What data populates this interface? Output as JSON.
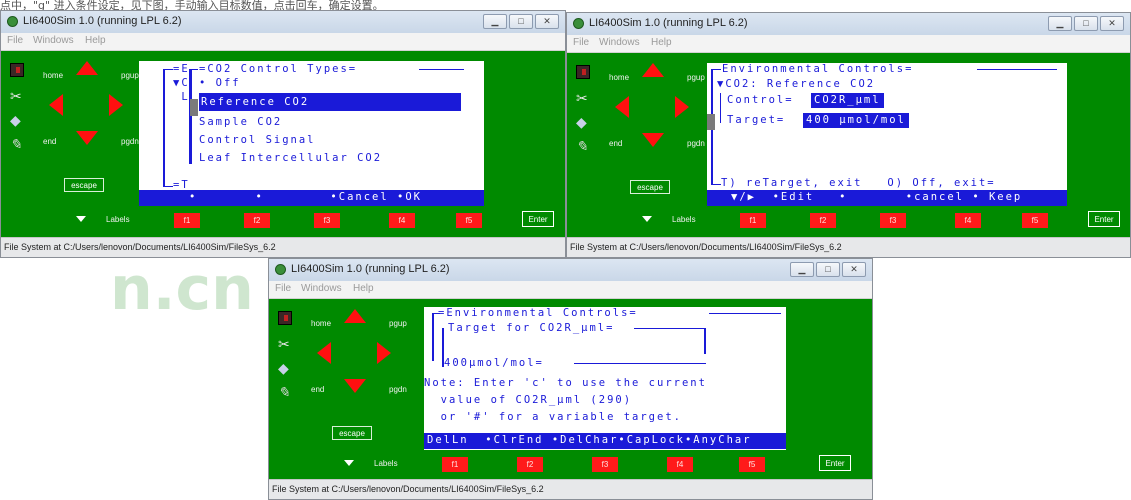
{
  "header_fragment": "点中，\"g\" 进入条件设定，见下图，手动输入目标数值，点击回车，确定设置。",
  "watermark": "n.cn",
  "colors": {
    "lcd_text": "#1a1ad8",
    "panel_green": "#008a00",
    "keys_red": "#ff1a1a"
  },
  "icons": [
    "app-icon",
    "minimize-icon",
    "maximize-icon",
    "close-icon",
    "record-tool-icon",
    "tools-icon",
    "chip-icon",
    "pen-icon",
    "up-arrow-icon",
    "down-arrow-icon",
    "left-arrow-icon",
    "right-arrow-icon",
    "labels-triangle-icon"
  ],
  "windows": [
    {
      "title": "LI6400Sim 1.0 (running LPL 6.2)",
      "menu": [
        "File",
        "Windows",
        "Help"
      ],
      "status": "File System at C:/Users/lenovon/Documents/LI6400Sim/FileSys_6.2",
      "controls": {
        "home": "home",
        "pgup": "pgup",
        "end": "end",
        "pgdn": "pgdn",
        "escape": "escape",
        "labels": "Labels",
        "enter": "Enter"
      },
      "fkeys": [
        "f1",
        "f2",
        "f3",
        "f4",
        "f5"
      ],
      "screen": {
        "bg_lines": [
          "=E",
          "▼C",
          " L",
          "",
          "",
          "",
          "",
          "",
          "=T"
        ],
        "box_title": "=CO2 Control Types=",
        "items": [
          "• Off",
          "Reference CO2",
          "Sample CO2",
          "Control Signal",
          "Leaf Intercellular CO2"
        ],
        "selected_index": 1,
        "bottom": "   •       •        •Cancel •OK"
      }
    },
    {
      "title": "LI6400Sim 1.0 (running LPL 6.2)",
      "menu": [
        "File",
        "Windows",
        "Help"
      ],
      "status": "File System at C:/Users/lenovon/Documents/LI6400Sim/FileSys_6.2",
      "controls": {
        "home": "home",
        "pgup": "pgup",
        "end": "end",
        "pgdn": "pgdn",
        "escape": "escape",
        "labels": "Labels",
        "enter": "Enter"
      },
      "fkeys": [
        "f1",
        "f2",
        "f3",
        "f4",
        "f5"
      ],
      "screen": {
        "title": "Environmental Controls=",
        "co2_line": "▼CO2: Reference CO2",
        "control_label": "Control=",
        "control_value": "CO2R_µml",
        "target_label": "Target=",
        "target_value": "400 µmol/mol",
        "footer_line": "T) reTarget, exit   O) Off, exit=",
        "bottom": "▼/▶  •Edit   •       •cancel • Keep"
      }
    },
    {
      "title": "LI6400Sim 1.0 (running LPL 6.2)",
      "menu": [
        "File",
        "Windows",
        "Help"
      ],
      "status": "File System at C:/Users/lenovon/Documents/LI6400Sim/FileSys_6.2",
      "controls": {
        "home": "home",
        "pgup": "pgup",
        "end": "end",
        "pgdn": "pgdn",
        "escape": "escape",
        "labels": "Labels",
        "enter": "Enter"
      },
      "fkeys": [
        "f1",
        "f2",
        "f3",
        "f4",
        "f5"
      ],
      "screen": {
        "title": "=Environmental Controls=",
        "box_title": "Target for CO2R_µml=",
        "value": "400µmol/mol=",
        "note_lines": [
          "Note: Enter 'c' to use the current",
          "  value of CO2R_µml (290)",
          "  or '#' for a variable target."
        ],
        "bottom": "DelLn  •ClrEnd •DelChar•CapLock•AnyChar"
      }
    }
  ]
}
